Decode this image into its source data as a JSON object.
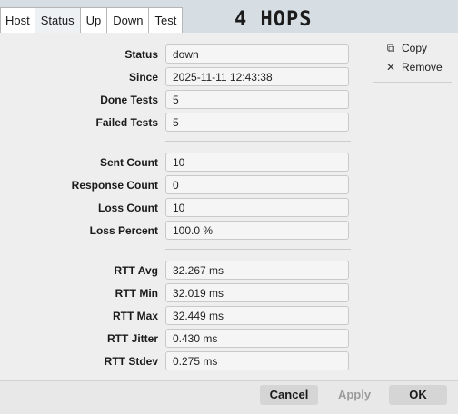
{
  "tabs": [
    "Host",
    "Status",
    "Up",
    "Down",
    "Test"
  ],
  "active_tab": "Status",
  "title": "4 HOPS",
  "side_actions": {
    "copy": {
      "label": "Copy",
      "icon": "copy-icon"
    },
    "remove": {
      "label": "Remove",
      "icon": "close-icon"
    }
  },
  "fields": {
    "status": {
      "label": "Status",
      "value": "down"
    },
    "since": {
      "label": "Since",
      "value": "2025-11-11 12:43:38"
    },
    "done_tests": {
      "label": "Done Tests",
      "value": "5"
    },
    "failed_tests": {
      "label": "Failed Tests",
      "value": "5"
    },
    "sent_count": {
      "label": "Sent Count",
      "value": "10"
    },
    "response_count": {
      "label": "Response Count",
      "value": "0"
    },
    "loss_count": {
      "label": "Loss Count",
      "value": "10"
    },
    "loss_percent": {
      "label": "Loss Percent",
      "value": "100.0 %"
    },
    "rtt_avg": {
      "label": "RTT Avg",
      "value": "32.267 ms"
    },
    "rtt_min": {
      "label": "RTT Min",
      "value": "32.019 ms"
    },
    "rtt_max": {
      "label": "RTT Max",
      "value": "32.449 ms"
    },
    "rtt_jitter": {
      "label": "RTT Jitter",
      "value": "0.430 ms"
    },
    "rtt_stdev": {
      "label": "RTT Stdev",
      "value": "0.275 ms"
    }
  },
  "footer": {
    "cancel": "Cancel",
    "apply": "Apply",
    "ok": "OK"
  }
}
